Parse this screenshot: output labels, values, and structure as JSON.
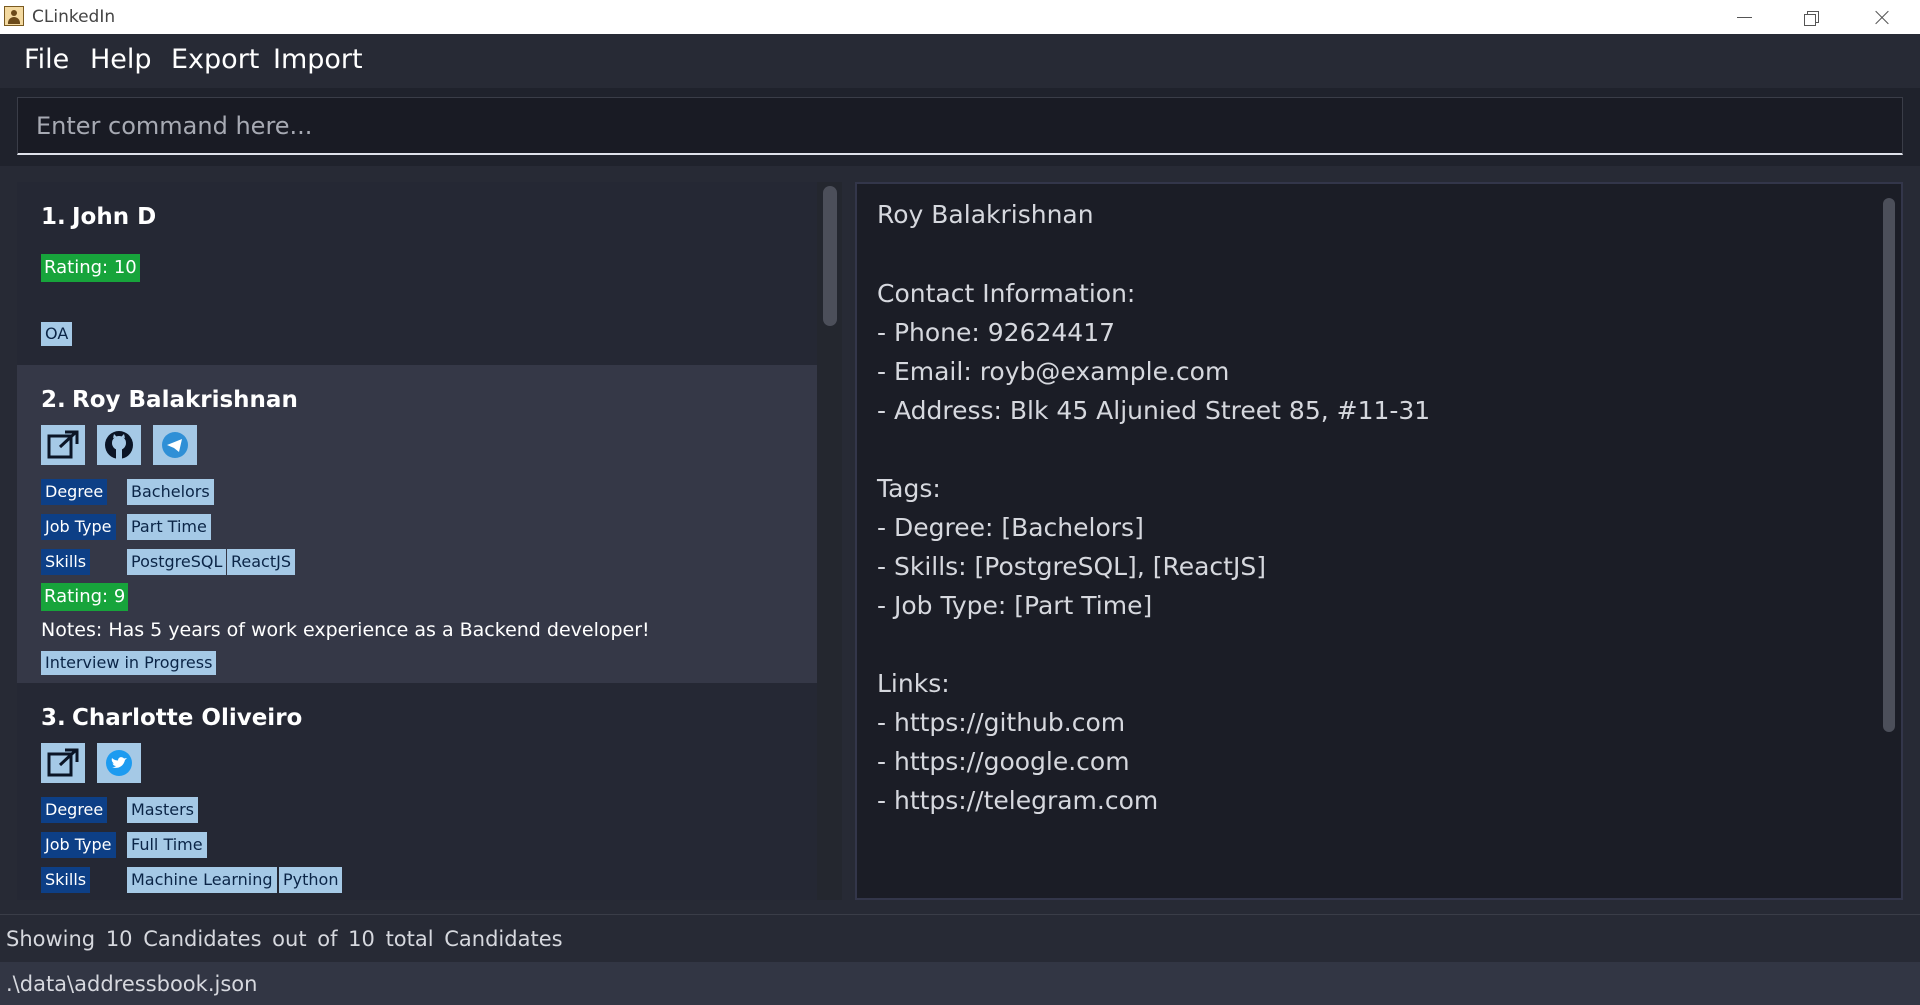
{
  "window": {
    "title": "CLinkedIn"
  },
  "menu": {
    "file": "File",
    "help": "Help",
    "export": "Export",
    "import": "Import"
  },
  "command": {
    "placeholder": "Enter command here...",
    "value": ""
  },
  "candidates": [
    {
      "index": "1.",
      "name": "John D",
      "rating": "Rating: 10",
      "status": "OA"
    },
    {
      "index": "2.",
      "name": "Roy Balakrishnan",
      "links": [
        "external-link-icon",
        "github-icon",
        "telegram-icon"
      ],
      "tags": {
        "degree_label": "Degree",
        "degree": "Bachelors",
        "jobtype_label": "Job Type",
        "jobtype": "Part Time",
        "skills_label": "Skills",
        "skills": [
          "PostgreSQL",
          "ReactJS"
        ]
      },
      "rating": "Rating: 9",
      "notes": "Notes: Has 5 years of work experience as a Backend developer!",
      "status": "Interview in Progress"
    },
    {
      "index": "3.",
      "name": "Charlotte Oliveiro",
      "links": [
        "external-link-icon",
        "twitter-icon"
      ],
      "tags": {
        "degree_label": "Degree",
        "degree": "Masters",
        "jobtype_label": "Job Type",
        "jobtype": "Full Time",
        "skills_label": "Skills",
        "skills": [
          "Machine Learning",
          "Python"
        ]
      }
    }
  ],
  "detail": {
    "name": "Roy Balakrishnan",
    "contact_header": "Contact Information:",
    "phone": "- Phone: 92624417",
    "email": "- Email: royb@example.com",
    "address": "- Address: Blk 45 Aljunied Street 85, #11-31",
    "tags_header": "Tags:",
    "tag_degree": "- Degree: [Bachelors]",
    "tag_skills": "- Skills: [PostgreSQL], [ReactJS]",
    "tag_jobtype": "- Job Type: [Part Time]",
    "links_header": "Links:",
    "links": [
      "- https://github.com",
      "- https://google.com",
      "- https://telegram.com"
    ]
  },
  "footer": {
    "result": "Showing  10  Candidates out of  10  total Candidates",
    "path": ".\\data\\addressbook.json"
  },
  "colors": {
    "rating_green": "#17a43b",
    "tag_key": "#0d3f86",
    "tag_value": "#a5c9e6"
  }
}
